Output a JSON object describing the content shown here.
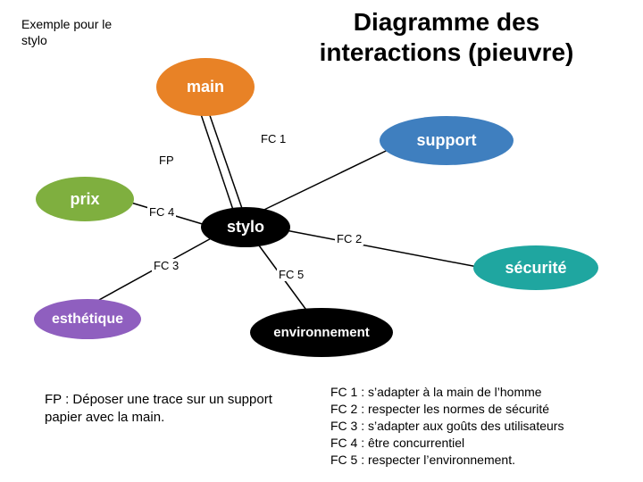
{
  "header": {
    "example_note_line1": "Exemple pour le",
    "example_note_line2": "stylo",
    "title_line1": "Diagramme des",
    "title_line2": "interactions (pieuvre)"
  },
  "nodes": {
    "main": "main",
    "support": "support",
    "prix": "prix",
    "stylo": "stylo",
    "securite": "sécurité",
    "esthetique": "esthétique",
    "environnement": "environnement"
  },
  "edges": {
    "fp": "FP",
    "fc1": "FC 1",
    "fc2": "FC 2",
    "fc3": "FC 3",
    "fc4": "FC 4",
    "fc5": "FC 5"
  },
  "legends": {
    "fp_full": "FP : Déposer une trace sur un support papier avec la main.",
    "fc1_full": "FC 1 : s’adapter à la main de l’homme",
    "fc2_full": "FC 2 : respecter les normes de sécurité",
    "fc3_full": "FC 3 : s’adapter aux goûts des utilisateurs",
    "fc4_full": "FC 4 : être concurrentiel",
    "fc5_full": "FC 5 : respecter l’environnement."
  },
  "colors": {
    "main": "#e88226",
    "support": "#3f7fbf",
    "prix": "#7faf3f",
    "stylo": "#000000",
    "securite": "#1fa6a0",
    "esthetique": "#8f5fbf",
    "environnement": "#000000"
  }
}
